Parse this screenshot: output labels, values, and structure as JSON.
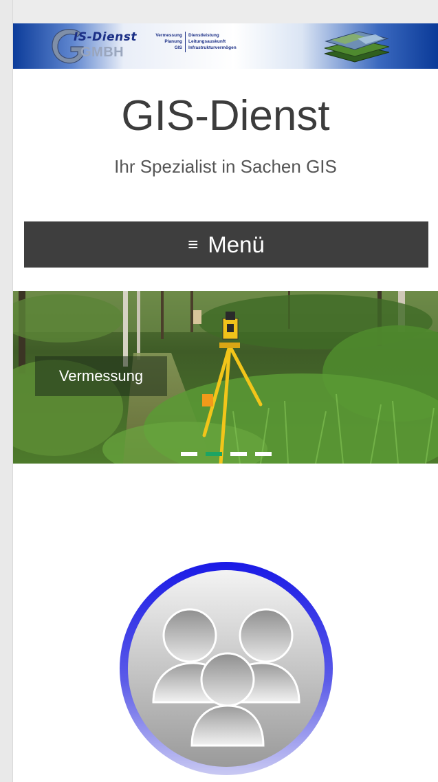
{
  "banner": {
    "logo_top": "IS-Dienst",
    "logo_bottom": "GMBH",
    "tagline_left": [
      "Vermessung",
      "Planung",
      "GIS"
    ],
    "tagline_right": [
      "Dienstleistung",
      "Leitungsauskunft",
      "Infrastrukturvermögen"
    ]
  },
  "header": {
    "title": "GIS-Dienst",
    "subtitle": "Ihr Spezialist in Sachen GIS"
  },
  "menu": {
    "icon": "≡",
    "label": "Menü"
  },
  "slider": {
    "caption": "Vermessung",
    "slide_count": 4,
    "active_index": 1,
    "active_color": "#1ca463"
  },
  "icons": {
    "team": "team-icon",
    "hamburger": "hamburger-icon"
  }
}
